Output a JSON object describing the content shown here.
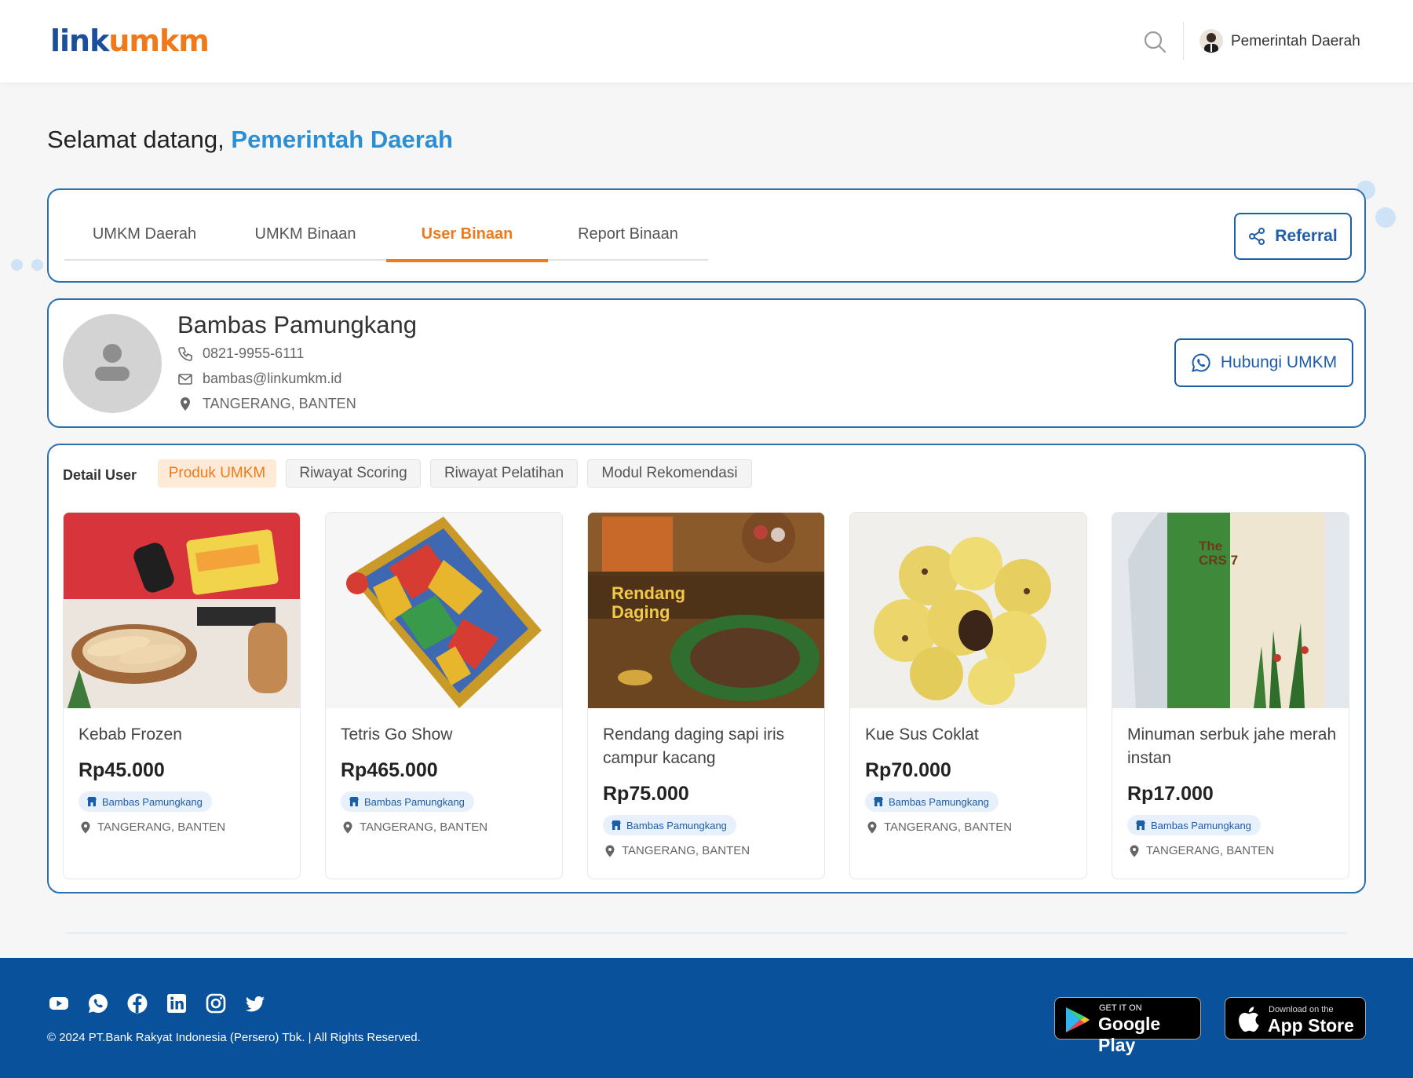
{
  "header": {
    "logo_part1": "link",
    "logo_part2": "umkm",
    "user_name": "Pemerintah Daerah"
  },
  "welcome": {
    "prefix": "Selamat datang,",
    "name": "Pemerintah Daerah"
  },
  "tabs": [
    {
      "label": "UMKM Daerah",
      "active": false
    },
    {
      "label": "UMKM Binaan",
      "active": false
    },
    {
      "label": "User Binaan",
      "active": true
    },
    {
      "label": "Report Binaan",
      "active": false
    }
  ],
  "referral_label": "Referral",
  "profile": {
    "name": "Bambas Pamungkang",
    "phone": "0821-9955-6111",
    "email": "bambas@linkumkm.id",
    "location": "TANGERANG, BANTEN",
    "contact_label": "Hubungi UMKM"
  },
  "detail": {
    "label": "Detail User",
    "subtabs": [
      {
        "label": "Produk UMKM",
        "active": true
      },
      {
        "label": "Riwayat Scoring",
        "active": false
      },
      {
        "label": "Riwayat Pelatihan",
        "active": false
      },
      {
        "label": "Modul Rekomendasi",
        "active": false
      }
    ]
  },
  "products": [
    {
      "name": "Kebab Frozen",
      "price": "Rp45.000",
      "seller": "Bambas Pamungkang",
      "location": "TANGERANG, BANTEN"
    },
    {
      "name": "Tetris Go Show",
      "price": "Rp465.000",
      "seller": "Bambas Pamungkang",
      "location": "TANGERANG, BANTEN"
    },
    {
      "name": "Rendang daging sapi iris campur kacang",
      "price": "Rp75.000",
      "seller": "Bambas Pamungkang",
      "location": "TANGERANG, BANTEN",
      "image_text_1": "Rendang",
      "image_text_2": "Daging"
    },
    {
      "name": "Kue Sus Coklat",
      "price": "Rp70.000",
      "seller": "Bambas Pamungkang",
      "location": "TANGERANG, BANTEN"
    },
    {
      "name": "Minuman serbuk jahe merah instan",
      "price": "Rp17.000",
      "seller": "Bambas Pamungkang",
      "location": "TANGERANG, BANTEN",
      "image_text_1": "The",
      "image_text_2": "CRS 7"
    }
  ],
  "footer": {
    "social_icons": [
      "youtube-icon",
      "whatsapp-icon",
      "facebook-icon",
      "linkedin-icon",
      "instagram-icon",
      "twitter-icon"
    ],
    "copyright": "© 2024 PT.Bank Rakyat Indonesia (Persero) Tbk. | All Rights Reserved.",
    "google_play_small": "GET IT ON",
    "google_play_big": "Google Play",
    "app_store_small": "Download on the",
    "app_store_big": "App Store"
  },
  "colors": {
    "brand_blue": "#1e5ea8",
    "accent_orange": "#ee7a1c",
    "highlight_blue": "#2d8fd3",
    "footer_blue": "#09529b"
  }
}
